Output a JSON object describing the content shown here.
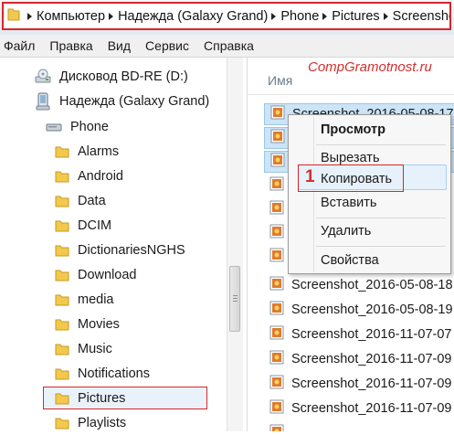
{
  "breadcrumb": [
    "Компьютер",
    "Надежда (Galaxy Grand)",
    "Phone",
    "Pictures",
    "Screenshots"
  ],
  "menu": [
    "Файл",
    "Правка",
    "Вид",
    "Сервис",
    "Справка"
  ],
  "nav": {
    "drive": "Дисковод BD-RE (D:)",
    "device": "Надежда (Galaxy Grand)",
    "phone": "Phone",
    "folders": [
      "Alarms",
      "Android",
      "Data",
      "DCIM",
      "DictionariesNGHS",
      "Download",
      "media",
      "Movies",
      "Music",
      "Notifications",
      "Pictures",
      "Playlists"
    ],
    "selected": "Pictures"
  },
  "files": {
    "column_header": "Имя",
    "items": [
      "Screenshot_2016-05-08-17",
      "Screenshot_2016-05-08-18",
      "Screenshot_2016-05-08-19",
      "Screenshot_2016-11-07-07",
      "Screenshot_2016-11-07-09",
      "Screenshot_2016-11-07-09",
      "Screenshot_2016-11-07-09"
    ]
  },
  "context_menu": {
    "items": [
      "Просмотр",
      "Вырезать",
      "Копировать",
      "Вставить",
      "Удалить",
      "Свойства"
    ],
    "highlighted": "Копировать",
    "annotation": "1"
  },
  "watermark": "CompGramotnost.ru",
  "colors": {
    "annotation_red": "#d6262b",
    "selection_blue": "#cce4f7",
    "folder_yellow": "#f2c94c"
  }
}
